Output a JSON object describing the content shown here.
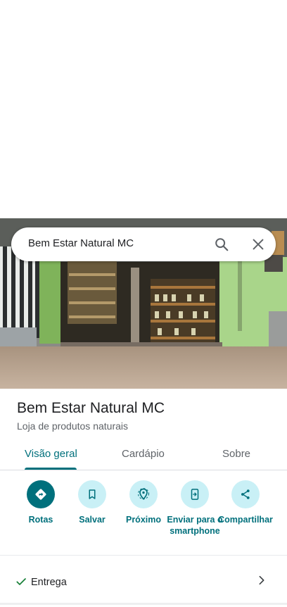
{
  "search": {
    "query": "Bem Estar Natural MC"
  },
  "place": {
    "name": "Bem Estar Natural MC",
    "category": "Loja de produtos naturais"
  },
  "tabs": [
    {
      "label": "Visão geral",
      "active": true
    },
    {
      "label": "Cardápio",
      "active": false
    },
    {
      "label": "Sobre",
      "active": false
    }
  ],
  "actions": [
    {
      "label": "Rotas",
      "icon": "directions-icon"
    },
    {
      "label": "Salvar",
      "icon": "bookmark-icon"
    },
    {
      "label": "Próximo",
      "icon": "nearby-icon"
    },
    {
      "label": "Enviar para o smartphone",
      "icon": "send-to-phone-icon"
    },
    {
      "label": "Compartilhar",
      "icon": "share-icon"
    }
  ],
  "services": {
    "label": "Entrega",
    "icon": "check-icon"
  },
  "colors": {
    "accent": "#00707c",
    "accent_light": "#c9f0f6",
    "check": "#188038"
  }
}
